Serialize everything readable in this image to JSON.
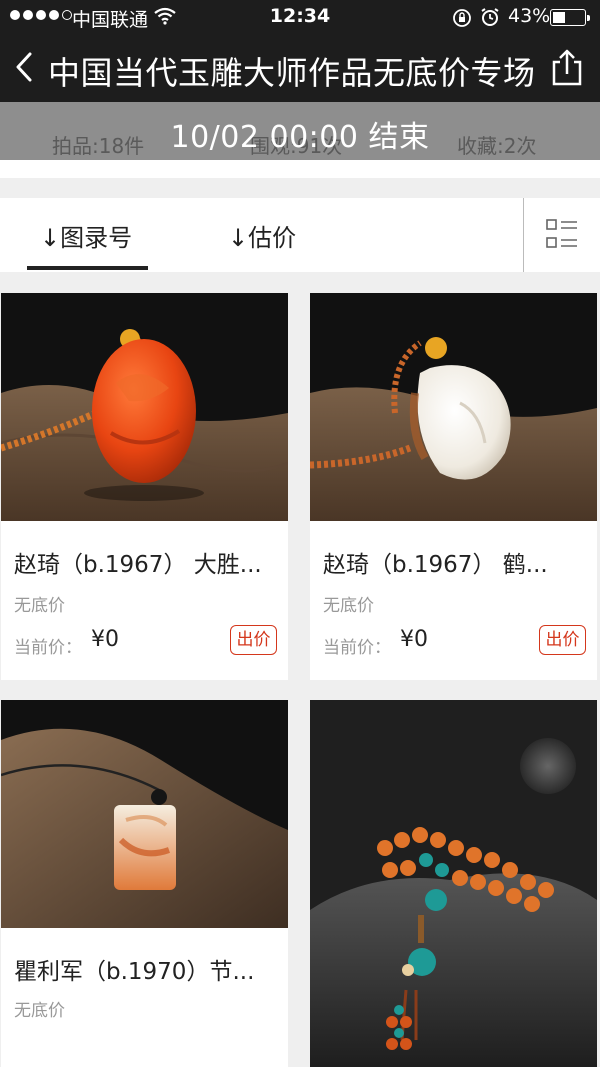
{
  "status_bar": {
    "carrier": "中国联通",
    "time": "12:34",
    "battery": "43%",
    "battery_level": 0.43
  },
  "nav": {
    "title": "中国当代玉雕大师作品无底价专场"
  },
  "info": {
    "lots": "拍品:18件",
    "views": "围观:91次",
    "favorites": "收藏:2次",
    "deadline": "10/02 00:00 结束"
  },
  "sort": {
    "catalog": "↓图录号",
    "estimate": "↓估价"
  },
  "items": [
    {
      "name": "赵琦（b.1967） 大胜...",
      "reserve": "无底价",
      "price_label": "当前价：",
      "price": "¥0",
      "bid": "出价"
    },
    {
      "name": "赵琦（b.1967） 鹤...",
      "reserve": "无底价",
      "price_label": "当前价：",
      "price": "¥0",
      "bid": "出价"
    },
    {
      "name": "瞿利军（b.1970）节...",
      "reserve": "无底价"
    }
  ],
  "colors": {
    "bar_bg": "#1d1d1d",
    "accent_red": "#d4371c",
    "muted_text": "#999999"
  }
}
